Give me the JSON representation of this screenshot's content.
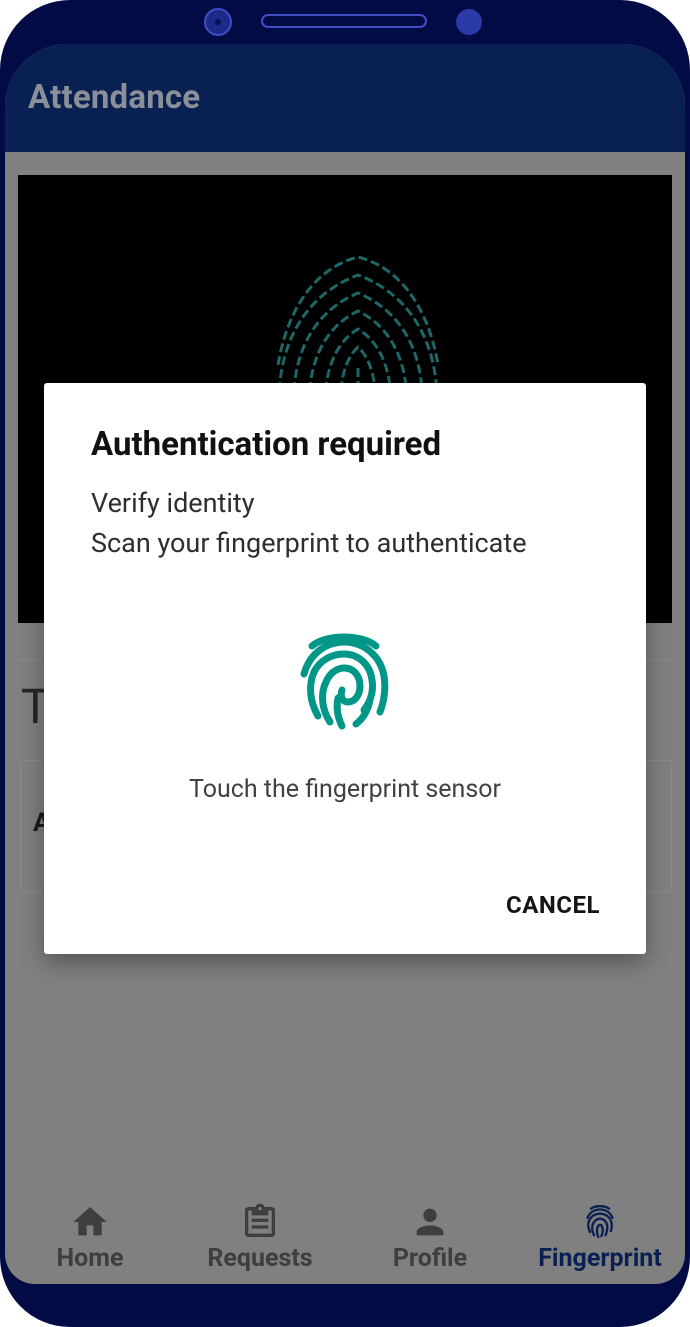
{
  "app": {
    "title": "Attendance"
  },
  "content": {
    "section_heading_partial": "T",
    "card_text_partial": "A"
  },
  "dialog": {
    "title": "Authentication required",
    "subtitle": "Verify identity",
    "description": "Scan your fingerprint to authenticate",
    "icon": "fingerprint-icon",
    "hint": "Touch the fingerprint sensor",
    "cancel_label": "CANCEL"
  },
  "bottom_nav": {
    "items": [
      {
        "label": "Home",
        "icon": "home-icon",
        "active": false
      },
      {
        "label": "Requests",
        "icon": "clipboard-icon",
        "active": false
      },
      {
        "label": "Profile",
        "icon": "person-icon",
        "active": false
      },
      {
        "label": "Fingerprint",
        "icon": "fingerprint-icon",
        "active": true
      }
    ]
  },
  "colors": {
    "appbar": "#092053",
    "scrim_background": "#808080",
    "accent_teal": "#009688",
    "nav_active": "#0b2052",
    "device_frame": "#030b45"
  }
}
